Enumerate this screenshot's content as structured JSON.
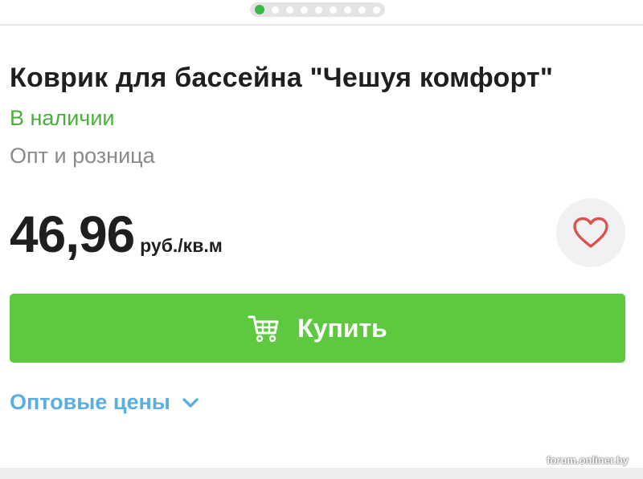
{
  "carousel": {
    "total_slides": 9,
    "active_index": 0
  },
  "product": {
    "title": "Коврик для бассейна \"Чешуя комфорт\"",
    "availability": "В наличии",
    "sale_type": "Опт и розница"
  },
  "price": {
    "value": "46,96",
    "unit": "руб./кв.м"
  },
  "favorite": {
    "icon": "heart-outline-icon"
  },
  "buy_button": {
    "label": "Купить",
    "icon": "cart-icon"
  },
  "wholesale": {
    "label": "Оптовые цены",
    "icon": "chevron-down-icon"
  },
  "watermark": "forum.onliner.by",
  "colors": {
    "accent_green": "#5cc93f",
    "in_stock_green": "#4caf3c",
    "link_blue": "#5aaee6",
    "heart_red": "#d9534f"
  }
}
